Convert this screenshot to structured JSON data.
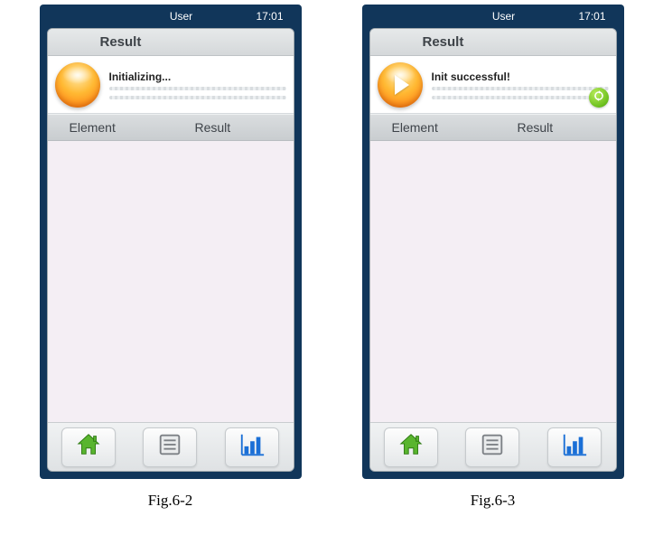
{
  "figures": [
    {
      "caption": "Fig.6-2",
      "statusbar": {
        "user": "User",
        "time": "17:01"
      },
      "title": "Result",
      "status_text": "Initializing...",
      "show_play": false,
      "show_refresh": false,
      "table": {
        "col_element": "Element",
        "col_result": "Result"
      }
    },
    {
      "caption": "Fig.6-3",
      "statusbar": {
        "user": "User",
        "time": "17:01"
      },
      "title": "Result",
      "status_text": "Init successful!",
      "show_play": true,
      "show_refresh": true,
      "table": {
        "col_element": "Element",
        "col_result": "Result"
      }
    }
  ],
  "icons": {
    "battery": "battery-charging-icon",
    "home": "home-icon",
    "list": "list-icon",
    "chart": "bar-chart-icon",
    "refresh": "refresh-icon",
    "play": "play-icon"
  }
}
